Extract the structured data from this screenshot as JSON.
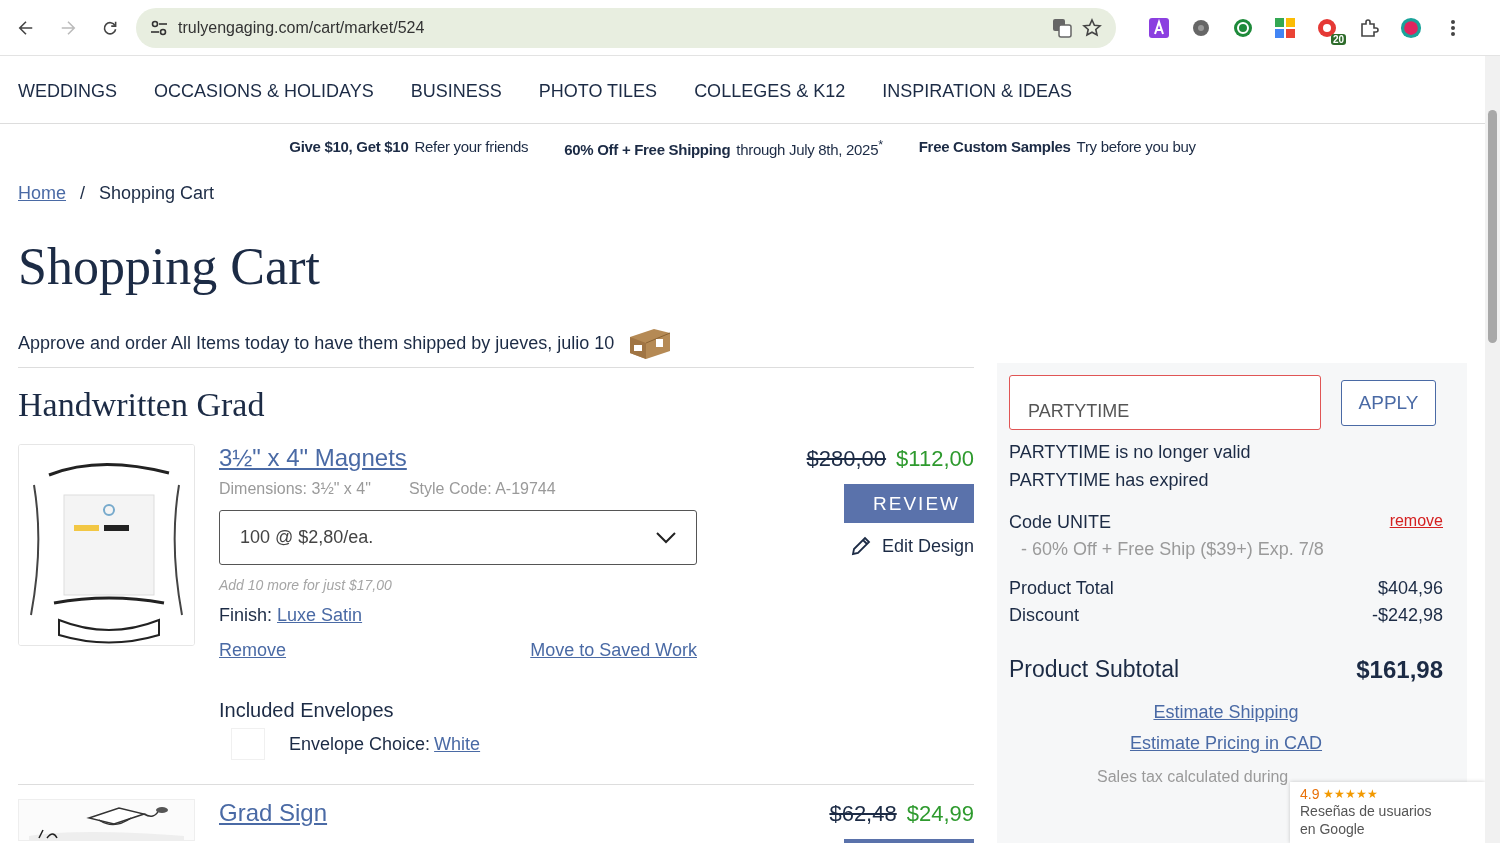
{
  "browser": {
    "url": "trulyengaging.com/cart/market/524",
    "forward_enabled": false,
    "extension_badge": "20"
  },
  "nav": [
    "WEDDINGS",
    "OCCASIONS & HOLIDAYS",
    "BUSINESS",
    "PHOTO TILES",
    "COLLEGES & K12",
    "INSPIRATION & IDEAS"
  ],
  "promos": [
    {
      "bold": "Give $10, Get $10",
      "text": "Refer your friends"
    },
    {
      "bold": "60% Off + Free Shipping",
      "text": "through July 8th, 2025$^{*}$"
    },
    {
      "bold": "Free Custom Samples",
      "text": "Try before you buy"
    }
  ],
  "breadcrumb": [
    {
      "label": "Home",
      "kind": "link"
    },
    {
      "label": "/",
      "kind": "separator"
    },
    {
      "label": "Shopping Cart",
      "kind": "current"
    }
  ],
  "title": "Shopping Cart",
  "ship_note": "Approve and order All Items today to have them shipped by jueves, julio 10",
  "section_title": "Handwritten Grad",
  "items": [
    {
      "title": "3½\" x 4\" Magnets",
      "dimensions": "Dimensions: 3½\" x 4\"",
      "style_code": "Style Code: A-19744",
      "quantity": "100 @ $2,80/ea.",
      "upsell": "Add 10 more for just $17,00",
      "finish_label": "Finish:",
      "finish": "Luxe Satin",
      "remove": "Remove",
      "move": "Move to Saved Work",
      "price_old": "$280,00",
      "price_new": "$112,00",
      "action": "REVIEW",
      "edit": "Edit Design",
      "envelopes": {
        "heading": "Included Envelopes",
        "choice_label": "Envelope Choice:",
        "choice": "White"
      }
    },
    {
      "title": "Grad Sign",
      "price_old": "$62,48",
      "price_new": "$24,99"
    }
  ],
  "summary": {
    "promo_field": {
      "value": "PARTYTIME",
      "error": true
    },
    "apply": "APPLY",
    "messages": [
      "PARTYTIME is no longer valid",
      "PARTYTIME has expired"
    ],
    "code": {
      "label": "Code UNITE",
      "remove": "remove",
      "detail": "- 60% Off + Free Ship ($39+) Exp. 7/8"
    },
    "lines": [
      {
        "label": "Product Total",
        "value": "$404,96"
      },
      {
        "label": "Discount",
        "value": "-$242,98"
      }
    ],
    "subtotal": {
      "label": "Product Subtotal",
      "value": "$161,98"
    },
    "links": [
      "Estimate Shipping",
      "Estimate Pricing in CAD"
    ],
    "tax_note": "Sales tax calculated during"
  },
  "google_badge": {
    "rating": "4.9",
    "stars": 5,
    "text": "Reseñas de usuarios en Google"
  }
}
